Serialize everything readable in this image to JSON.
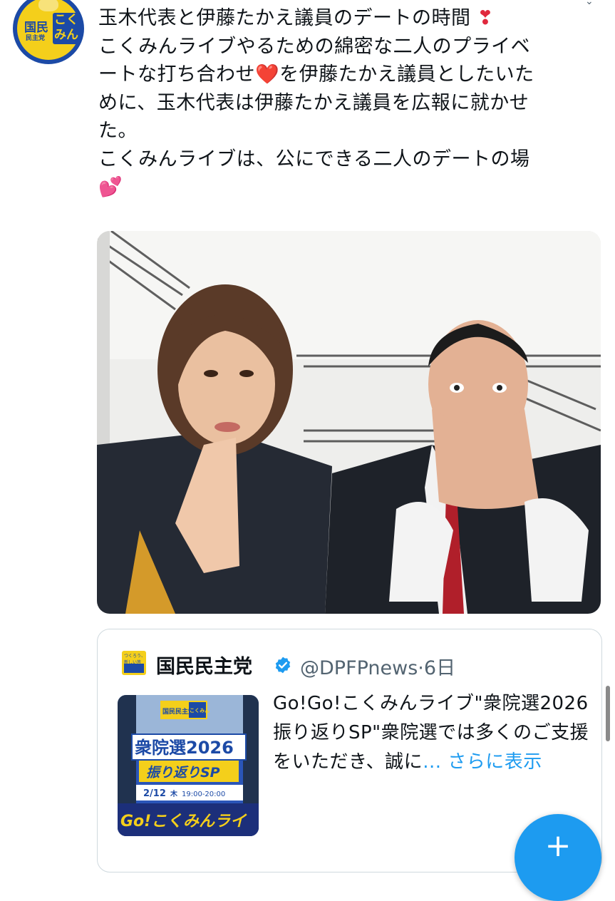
{
  "avatar": {
    "party_short": "国民",
    "party_small": "民主党",
    "show": "こくみん"
  },
  "tweet": {
    "lines": [
      "玉木代表と伊藤たかえ議員のデートの時間",
      "こくみんライブやるための綿密な二人のプライベ",
      "ートな打ち合わせ",
      "を伊藤たかえ議員としたいた",
      "めに、玉木代表は伊藤たかえ議員を広報に就かせ",
      "た。",
      "こくみんライブは、公にできる二人のデートの場"
    ],
    "emoji_exclaim": "❣",
    "emoji_heart": "❤️",
    "emoji_hearts": "💕"
  },
  "quote": {
    "logo_small": "つくろう、新しい答え。",
    "name": "国民民主党",
    "handle": "@DPFPnews",
    "separator": "·",
    "time": "6日",
    "text": "Go!Go!こくみんライブ\"衆院選2026 振り返りSP\"衆院選では多くのご支援をいただき、誠に",
    "ellipsis": "... ",
    "more": "さらに表示",
    "thumb": {
      "badge": "国民民主党",
      "badge2": "こくみん",
      "title1": "衆院選2026",
      "title2": "振り返りSP",
      "date": "2/12",
      "weekday": "木",
      "time": "19:00-20:00",
      "footer": "Go!こくみんライ"
    }
  },
  "fab": {
    "icon": "+"
  },
  "colors": {
    "accent": "#1d9bf0",
    "text": "#0f1419",
    "muted": "#536471",
    "party_blue": "#1c4aa6",
    "party_yellow": "#f4cf1b"
  }
}
